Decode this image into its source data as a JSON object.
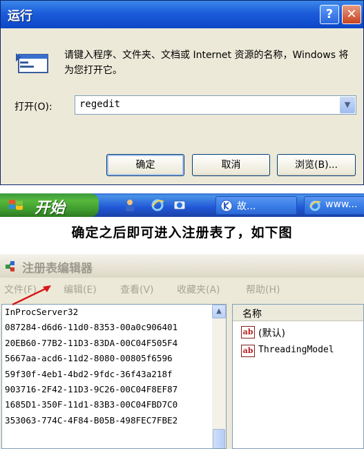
{
  "run_dialog": {
    "title": "运行",
    "help_glyph": "?",
    "close_glyph": "✕",
    "description": "请键入程序、文件夹、文档或 Internet 资源的名称，Windows 将为您打开它。",
    "open_label": "打开(O):",
    "open_value": "regedit",
    "ok_label": "确定",
    "cancel_label": "取消",
    "browse_label": "浏览(B)..."
  },
  "taskbar": {
    "start_label": "开始",
    "tasks": [
      {
        "label": "故..."
      },
      {
        "label": "www..."
      }
    ]
  },
  "caption": "确定之后即可进入注册表了，如下图",
  "regedit": {
    "title": "注册表编辑器",
    "menu": [
      "文件(F)",
      "编辑(E)",
      "查看(V)",
      "收藏夹(A)",
      "帮助(H)"
    ],
    "tree_items": [
      "InProcServer32",
      "087284-d6d6-11d0-8353-00a0c906401",
      "20EB60-77B2-11D3-83DA-00C04F505F4",
      "5667aa-acd6-11d2-8080-00805f6596",
      "59f30f-4eb1-4bd2-9fdc-36f43a218f",
      "903716-2F42-11D3-9C26-00C04F8EF87",
      "1685D1-350F-11d1-83B3-00C04FBD7C0",
      "353063-774C-4F84-B05B-498FEC7FBE2"
    ],
    "column_header": "名称",
    "values": [
      {
        "icon": "ab",
        "name": "(默认)"
      },
      {
        "icon": "ab",
        "name": "ThreadingModel"
      }
    ]
  },
  "colors": {
    "xp_blue": "#1c5ddb",
    "start_green": "#3f9b2f",
    "dialog_bg": "#ece9d8",
    "annotation_red": "#d81818"
  }
}
